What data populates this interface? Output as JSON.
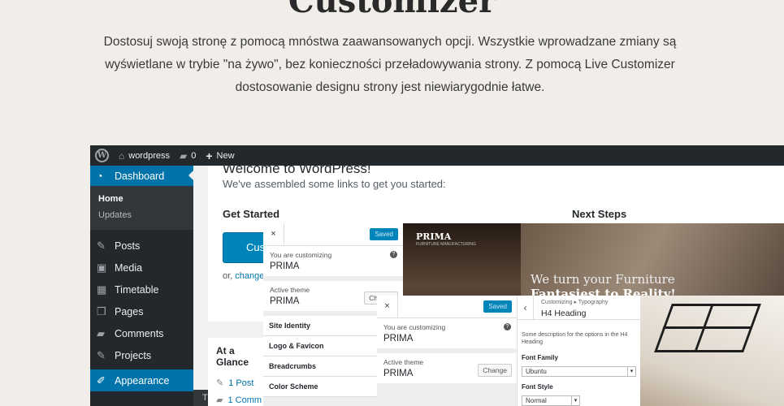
{
  "section": {
    "title": "Customizer",
    "intro": "Dostosuj swoją stronę z pomocą mnóstwa zaawansowanych opcji. Wszystkie wprowadzane zmiany są wyświetlane w trybie \"na żywo\", bez konieczności przeładowywania strony. Z pomocą Live Customizer dostosowanie designu strony jest niewiarygodnie łatwe."
  },
  "admin_bar": {
    "site_name": "wordpress",
    "comments_count": "0",
    "new_label": "New"
  },
  "sidebar": {
    "dashboard": "Dashboard",
    "submenu": [
      "Home",
      "Updates"
    ],
    "items": [
      "Posts",
      "Media",
      "Timetable",
      "Pages",
      "Comments",
      "Projects"
    ],
    "active": "Appearance",
    "flyout": "Themes"
  },
  "welcome": {
    "title": "Welcome to WordPress!",
    "subtitle": "We've assembled some links to get you started:",
    "get_started": "Get Started",
    "next_steps": "Next Steps",
    "button": "Cus",
    "or_text": "or,",
    "or_link": "change"
  },
  "glance": {
    "title": "At a Glance",
    "posts": "1 Post",
    "comments": "1 Comm"
  },
  "customizer": {
    "close": "×",
    "saved": "Saved",
    "customizing_label": "You are customizing",
    "site": "PRIMA",
    "active_theme_label": "Active theme",
    "theme": "PRIMA",
    "change_label": "Change",
    "sections": [
      "Site Identity",
      "Logo & Favicon",
      "Breadcrumbs",
      "Color Scheme"
    ]
  },
  "typography": {
    "breadcrumb": "Customizing ▸ Typography",
    "title": "H4 Heading",
    "description": "Some description for the options in the H4 Heading",
    "font_family_label": "Font Family",
    "font_family": "Ubuntu",
    "font_style_label": "Font Style",
    "font_style": "Normal"
  },
  "preview": {
    "brand": "PRIMA",
    "brand_sub": "FURNITURE MANUFACTURING",
    "hero_line1": "We turn your Furniture",
    "hero_line2": "Fantasiest to Reality!"
  }
}
